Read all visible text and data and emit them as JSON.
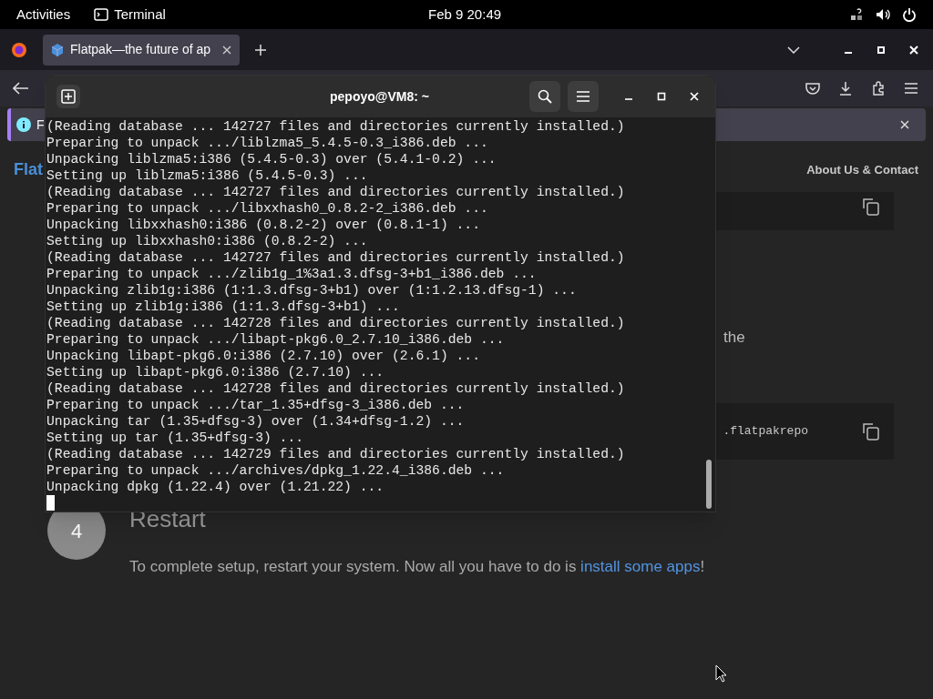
{
  "top_bar": {
    "activities": "Activities",
    "app_name": "Terminal",
    "clock": "Feb 9  20:49"
  },
  "browser": {
    "tab_title": "Flatpak—the future of ap",
    "notification": "F",
    "page": {
      "logo_text": "Flat",
      "nav_link": "About Us & Contact",
      "fragment_text": "the",
      "code_text": ".flatpakrepo",
      "step": {
        "number": "4",
        "title": "Restart",
        "text_before": "To complete setup, restart your system. Now all you have to do is ",
        "link": "install some apps",
        "text_after": "!"
      }
    }
  },
  "terminal": {
    "title": "pepoyo@VM8: ~",
    "lines": [
      "(Reading database ... 142727 files and directories currently installed.)",
      "Preparing to unpack .../liblzma5_5.4.5-0.3_i386.deb ...",
      "Unpacking liblzma5:i386 (5.4.5-0.3) over (5.4.1-0.2) ...",
      "Setting up liblzma5:i386 (5.4.5-0.3) ...",
      "(Reading database ... 142727 files and directories currently installed.)",
      "Preparing to unpack .../libxxhash0_0.8.2-2_i386.deb ...",
      "Unpacking libxxhash0:i386 (0.8.2-2) over (0.8.1-1) ...",
      "Setting up libxxhash0:i386 (0.8.2-2) ...",
      "(Reading database ... 142727 files and directories currently installed.)",
      "Preparing to unpack .../zlib1g_1%3a1.3.dfsg-3+b1_i386.deb ...",
      "Unpacking zlib1g:i386 (1:1.3.dfsg-3+b1) over (1:1.2.13.dfsg-1) ...",
      "Setting up zlib1g:i386 (1:1.3.dfsg-3+b1) ...",
      "(Reading database ... 142728 files and directories currently installed.)",
      "Preparing to unpack .../libapt-pkg6.0_2.7.10_i386.deb ...",
      "Unpacking libapt-pkg6.0:i386 (2.7.10) over (2.6.1) ...",
      "Setting up libapt-pkg6.0:i386 (2.7.10) ...",
      "(Reading database ... 142728 files and directories currently installed.)",
      "Preparing to unpack .../tar_1.35+dfsg-3_i386.deb ...",
      "Unpacking tar (1.35+dfsg-3) over (1.34+dfsg-1.2) ...",
      "Setting up tar (1.35+dfsg-3) ...",
      "(Reading database ... 142729 files and directories currently installed.)",
      "Preparing to unpack .../archives/dpkg_1.22.4_i386.deb ...",
      "Unpacking dpkg (1.22.4) over (1.21.22) ..."
    ]
  }
}
